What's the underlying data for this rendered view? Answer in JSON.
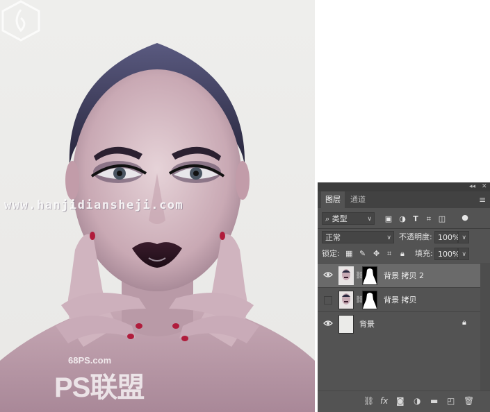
{
  "watermark": "www.hanjidiansheji.com",
  "logo": {
    "url": "68PS.com",
    "text": "PS联盟"
  },
  "panel": {
    "collapse_icon": "double-chevron",
    "close_icon": "close",
    "tabs": [
      {
        "label": "图层",
        "active": true
      },
      {
        "label": "通道",
        "active": false
      }
    ],
    "filter": {
      "label": "类型",
      "icons": [
        "image-filter",
        "adjustment-filter",
        "type-filter",
        "shape-filter",
        "smart-object-filter",
        "toggle-dot"
      ]
    },
    "blend_mode": "正常",
    "opacity_label": "不透明度:",
    "opacity_value": "100%",
    "lock_label": "锁定:",
    "fill_label": "填充:",
    "fill_value": "100%",
    "layers": [
      {
        "name": "背景 拷贝 2",
        "visible": true,
        "selected": true,
        "has_mask": true
      },
      {
        "name": "背景 拷贝",
        "visible": false,
        "selected": false,
        "has_mask": true
      },
      {
        "name": "背景",
        "visible": true,
        "selected": false,
        "has_mask": false,
        "locked": true
      }
    ],
    "bottom_icons": [
      "link",
      "fx",
      "add-mask",
      "adjustment",
      "group",
      "new-layer",
      "delete"
    ]
  }
}
